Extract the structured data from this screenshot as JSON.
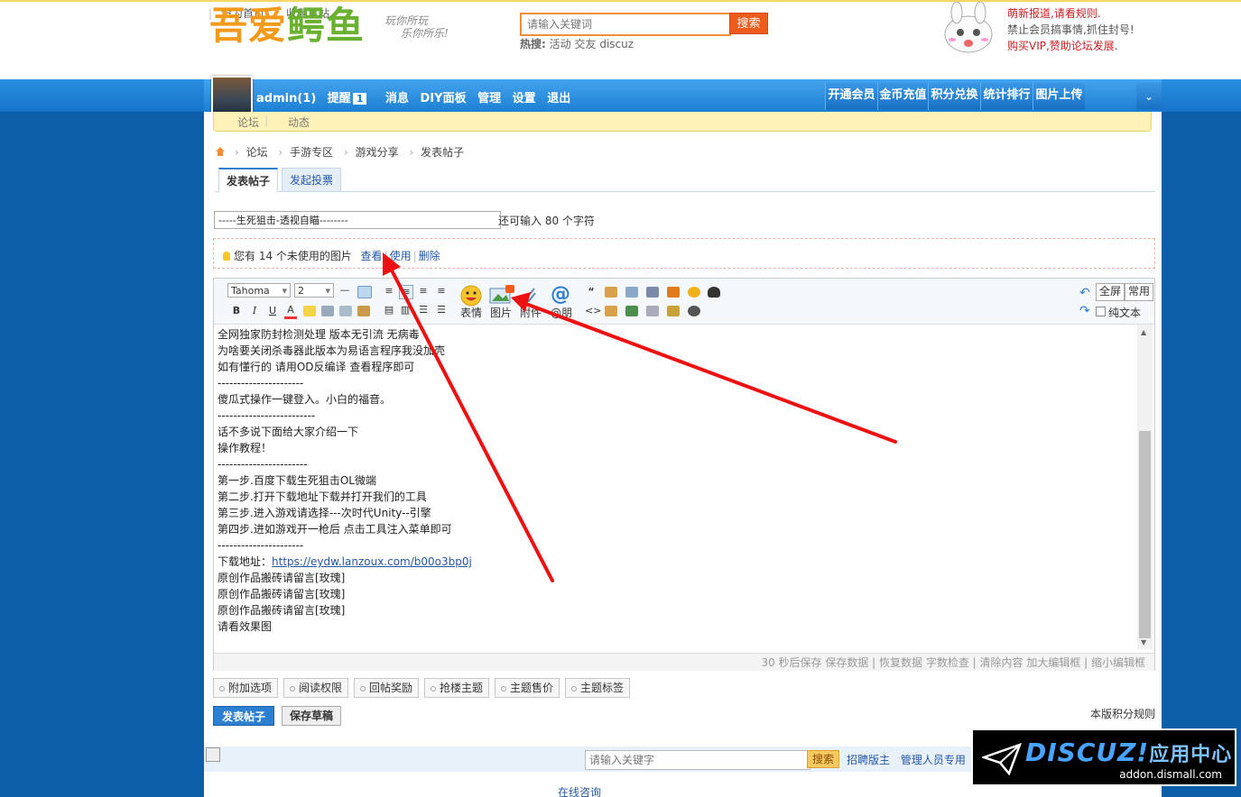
{
  "topbar": {
    "set_home": "设为首页",
    "bookmark": "收藏本站"
  },
  "header": {
    "logo_part1": "吾爱",
    "logo_part2": "鳄鱼",
    "slogan_line1": "玩你所玩",
    "slogan_line2": "乐你所乐!",
    "search_placeholder": "请输入关键词",
    "search_button": "搜索",
    "hot_label": "热搜:",
    "hot_terms": [
      "活动",
      "交友",
      "discuz"
    ],
    "notice_line1": "萌新报道,请看规则.",
    "notice_line2": "禁止会员搞事情,抓住封号!",
    "notice_line3": "购买VIP,赞助论坛发展."
  },
  "usernav": {
    "username": "admin(1)",
    "remind": "提醒",
    "remind_count": "1",
    "messages": "消息",
    "diy": "DIY面板",
    "manage": "管理",
    "settings": "设置",
    "logout": "退出"
  },
  "quicknav": [
    "开通会员",
    "金币充值",
    "积分兑换",
    "统计排行",
    "图片上传"
  ],
  "subnav": {
    "forum": "论坛",
    "feed": "动态"
  },
  "breadcrumb": [
    "论坛",
    "手游专区",
    "游戏分享",
    "发表帖子"
  ],
  "tabs": {
    "post": "发表帖子",
    "poll": "发起投票"
  },
  "title": {
    "value": "-----生死狙击-透视自瞄--------",
    "hint": "还可输入 80 个字符"
  },
  "image_notice": {
    "text": "您有 14 个未使用的图片",
    "view": "查看",
    "use": "使用",
    "delete": "删除"
  },
  "toolbar": {
    "font": "Tahoma",
    "size": "2",
    "emoji_label": "表情",
    "image_label": "图片",
    "attach_label": "附件",
    "at_label": "@朋",
    "fullscreen": "全屏",
    "common": "常用",
    "plaintext": "纯文本"
  },
  "content_lines": [
    "全网独家防封检测处理 版本无引流  无病毒",
    "为啥要关闭杀毒器此版本为易语言程序我没加壳",
    "如有懂行的  请用OD反编译 查看程序即可",
    "----------------------",
    "傻瓜式操作一键登入。小白的福音。",
    "-------------------------",
    "话不多说下面给大家介绍一下",
    "操作教程！",
    "-----------------------",
    "第一步.百度下载生死狙击OL微端",
    "第二步.打开下载地址下载并打开我们的工具",
    "第三步.进入游戏请选择---次时代Unity--引擎",
    "第四步.进如游戏开一枪后 点击工具注入菜单即可",
    "----------------------",
    "下载地址：",
    "原创作品搬砖请留言[玫瑰]",
    "原创作品搬砖请留言[玫瑰]",
    "原创作品搬砖请留言[玫瑰]",
    "请看效果图"
  ],
  "download_url": "https://eydw.lanzoux.com/b00o3bp0j",
  "statusbar": "30 秒后保存 保存数据 | 恢复数据    字数检查 | 清除内容    加大编辑框 | 缩小编辑框",
  "options": [
    "附加选项",
    "阅读权限",
    "回帖奖励",
    "抢楼主题",
    "主题售价",
    "主题标签"
  ],
  "actions": {
    "submit": "发表帖子",
    "draft": "保存草稿",
    "rules": "本版积分规则"
  },
  "footer": {
    "search_placeholder": "请输入关键字",
    "search_button": "搜索",
    "links": [
      "招聘版主",
      "管理人员专用"
    ],
    "online": "在线咨询"
  },
  "watermark": {
    "title": "DISCUZ!",
    "title_cn": "应用中心",
    "url": "addon.dismall.com"
  },
  "colors": {
    "nav_blue": "#1d7fd3",
    "accent_orange": "#f05a1a",
    "annotation_red": "#ee1111"
  }
}
